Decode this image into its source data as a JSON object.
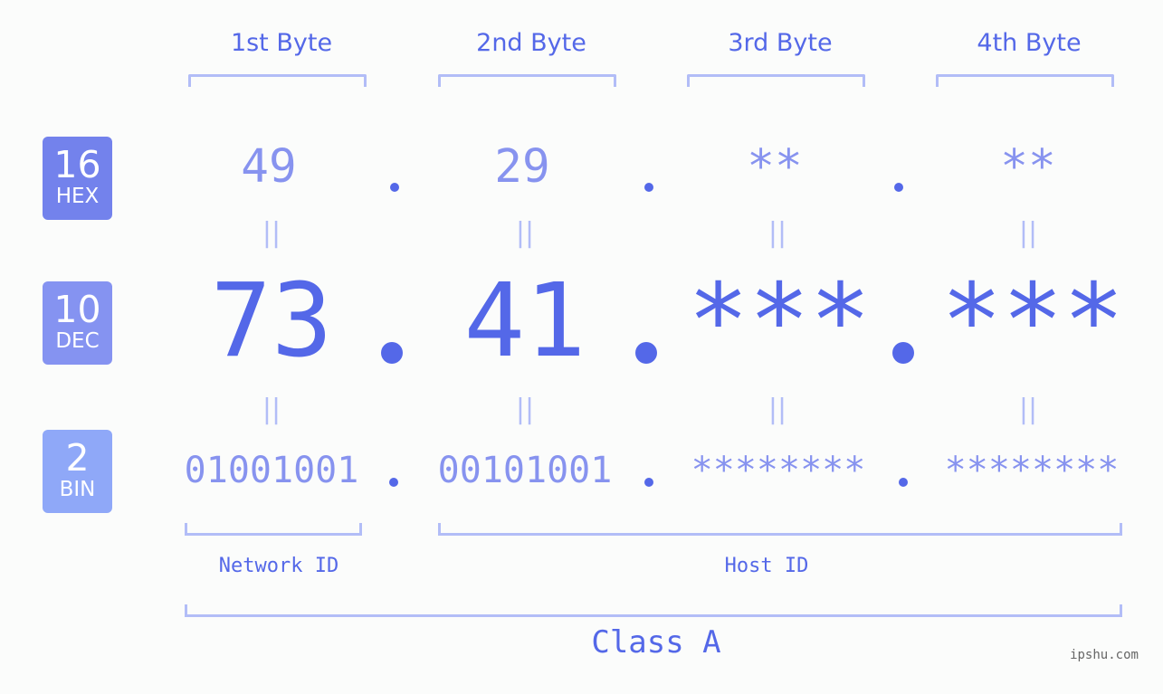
{
  "colors": {
    "primary": "#5468e8",
    "light_value": "#8793ef",
    "bracket": "#b2bdf7",
    "hex_badge": "#7382ec",
    "dec_badge": "#8593f1",
    "bin_badge": "#8fa8f8",
    "background": "#fbfcfb"
  },
  "byte_headers": [
    "1st Byte",
    "2nd Byte",
    "3rd Byte",
    "4th Byte"
  ],
  "badges": {
    "hex": {
      "number": "16",
      "label": "HEX"
    },
    "dec": {
      "number": "10",
      "label": "DEC"
    },
    "bin": {
      "number": "2",
      "label": "BIN"
    }
  },
  "hex_values": [
    "49",
    "29",
    "**",
    "**"
  ],
  "dec_values": [
    "73",
    "41",
    "***",
    "***"
  ],
  "bin_values": [
    "01001001",
    "00101001",
    "********",
    "********"
  ],
  "equals_symbol": "||",
  "network_label": "Network ID",
  "host_label": "Host ID",
  "class_label": "Class A",
  "watermark": "ipshu.com"
}
